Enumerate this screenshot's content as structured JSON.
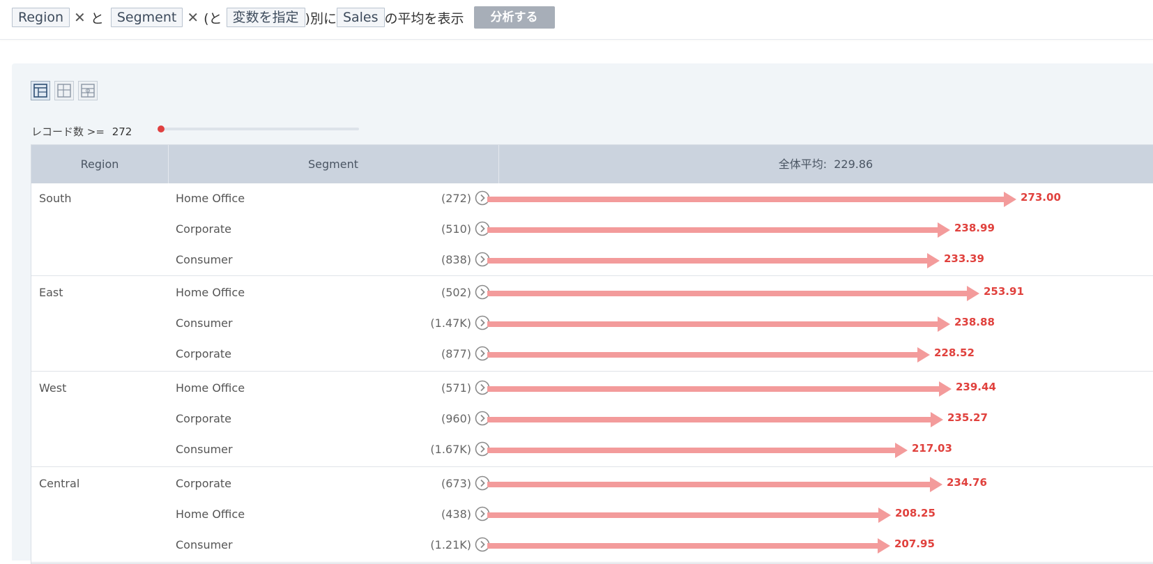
{
  "query": {
    "var1": "Region",
    "conj1": "と",
    "var2": "Segment",
    "conj2": "(と",
    "var3_placeholder": "変数を指定",
    "conj3": ")別に",
    "target": "Sales",
    "suffix": "の平均を表示",
    "analyze_button": "分析する"
  },
  "filter": {
    "label": "レコード数 >=",
    "value": "272",
    "slider_fraction": 0
  },
  "table": {
    "headers": {
      "region": "Region",
      "segment": "Segment",
      "avg_label": "全体平均:",
      "avg_value": "229.86"
    },
    "groups": [
      {
        "region": "South",
        "rows": [
          {
            "segment": "Home Office",
            "count": "(272)",
            "value": 273.0,
            "label": "273.00"
          },
          {
            "segment": "Corporate",
            "count": "(510)",
            "value": 238.99,
            "label": "238.99"
          },
          {
            "segment": "Consumer",
            "count": "(838)",
            "value": 233.39,
            "label": "233.39"
          }
        ]
      },
      {
        "region": "East",
        "rows": [
          {
            "segment": "Home Office",
            "count": "(502)",
            "value": 253.91,
            "label": "253.91"
          },
          {
            "segment": "Consumer",
            "count": "(1.47K)",
            "value": 238.88,
            "label": "238.88"
          },
          {
            "segment": "Corporate",
            "count": "(877)",
            "value": 228.52,
            "label": "228.52"
          }
        ]
      },
      {
        "region": "West",
        "rows": [
          {
            "segment": "Home Office",
            "count": "(571)",
            "value": 239.44,
            "label": "239.44"
          },
          {
            "segment": "Corporate",
            "count": "(960)",
            "value": 235.27,
            "label": "235.27"
          },
          {
            "segment": "Consumer",
            "count": "(1.67K)",
            "value": 217.03,
            "label": "217.03"
          }
        ]
      },
      {
        "region": "Central",
        "rows": [
          {
            "segment": "Corporate",
            "count": "(673)",
            "value": 234.76,
            "label": "234.76"
          },
          {
            "segment": "Home Office",
            "count": "(438)",
            "value": 208.25,
            "label": "208.25"
          },
          {
            "segment": "Consumer",
            "count": "(1.21K)",
            "value": 207.95,
            "label": "207.95"
          }
        ]
      }
    ],
    "bar_color": "#f39b9b",
    "value_color": "#e0413d"
  }
}
